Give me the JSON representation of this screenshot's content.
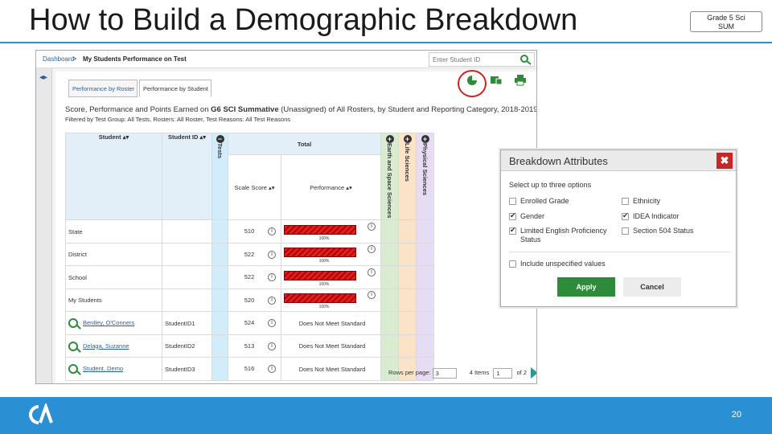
{
  "slide": {
    "title": "How to Build a Demographic Breakdown",
    "badge_line1": "Grade 5 Sci",
    "badge_line2": "SUM",
    "page_number": "20",
    "accent_color": "#2b8fd4"
  },
  "app": {
    "breadcrumb_home": "Dashboard",
    "breadcrumb_sep": ">",
    "breadcrumb_current": "My Students Performance on Test",
    "search_placeholder": "Enter Student ID",
    "tabs": [
      "Performance by Roster",
      "Performance by Student"
    ],
    "heading_pre": "Score, Performance and Points Earned on ",
    "heading_bold": "G6 SCI Summative",
    "heading_post": " (Unassigned) of All Rosters, by Student and Reporting Category, 2018-2019",
    "filter_text": "Filtered by Test Group: All Tests, Rosters: All Roster, Test Reasons: All Test Reasons",
    "columns": {
      "student": "Student",
      "student_id": "Student ID",
      "tests": "Tests",
      "total": "Total",
      "scale_score": "Scale Score",
      "performance": "Performance",
      "earth": "Earth and Space Sciences",
      "life": "Life Sciences",
      "physical": "Physical Sciences"
    },
    "summary_rows": [
      {
        "name": "State",
        "score": "510",
        "bar_label": "100%"
      },
      {
        "name": "District",
        "score": "522",
        "bar_label": "100%"
      },
      {
        "name": "School",
        "score": "522",
        "bar_label": "100%"
      },
      {
        "name": "My Students",
        "score": "520",
        "bar_label": "100%"
      }
    ],
    "student_rows": [
      {
        "name": "Bentley, O'Conners",
        "id": "StudentID1",
        "score": "524",
        "performance": "Does Not Meet Standard"
      },
      {
        "name": "Delaga, Suzanne",
        "id": "StudentID2",
        "score": "513",
        "performance": "Does Not Meet Standard"
      },
      {
        "name": "Student, Demo",
        "id": "StudentID3",
        "score": "516",
        "performance": "Does Not Meet Standard"
      }
    ],
    "pager": {
      "rows_label": "Rows per page:",
      "rows_value": "3",
      "items": "4 Items",
      "page_value": "1",
      "of_label": "of 2"
    }
  },
  "dialog": {
    "title": "Breakdown Attributes",
    "close": "✖",
    "prompt": "Select up to three options",
    "options": [
      {
        "label": "Enrolled Grade",
        "checked": false
      },
      {
        "label": "Ethnicity",
        "checked": false
      },
      {
        "label": "Gender",
        "checked": true
      },
      {
        "label": "IDEA Indicator",
        "checked": true
      },
      {
        "label": "Limited English Proficiency Status",
        "checked": true
      },
      {
        "label": "Section 504 Status",
        "checked": false
      }
    ],
    "include_unspecified": "Include unspecified values",
    "apply": "Apply",
    "cancel": "Cancel"
  }
}
